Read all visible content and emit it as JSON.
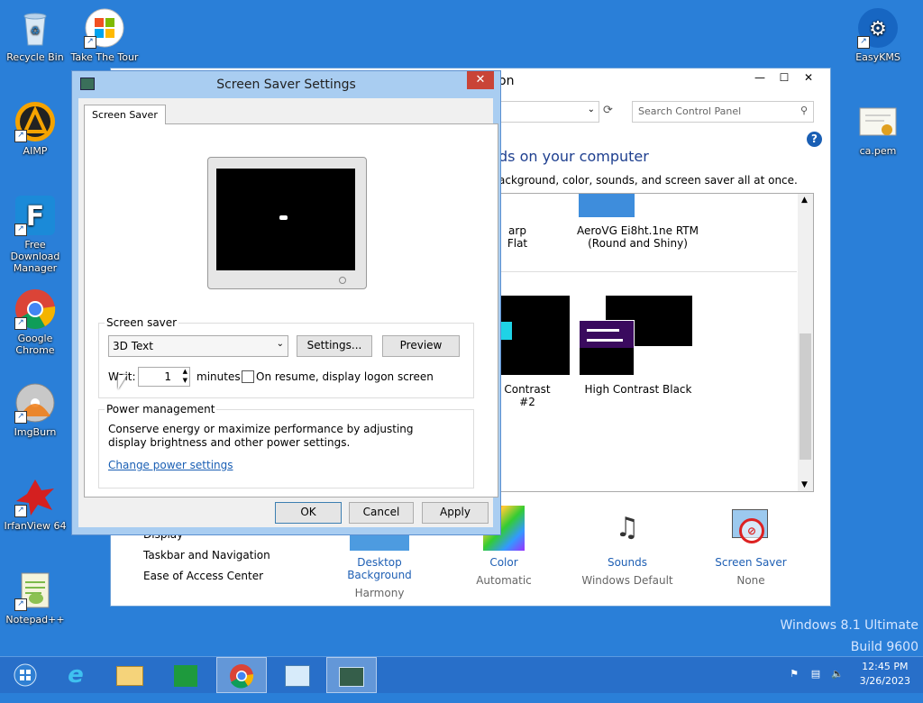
{
  "desktop": {
    "icons": [
      {
        "label": "Recycle Bin",
        "icon": "recycle-bin-icon"
      },
      {
        "label": "Take The Tour",
        "icon": "windows-logo-icon"
      },
      {
        "label": "AIMP",
        "icon": "aimp-icon"
      },
      {
        "label": "Free Download Manager",
        "icon": "fdm-icon"
      },
      {
        "label": "Google Chrome",
        "icon": "chrome-icon"
      },
      {
        "label": "ImgBurn",
        "icon": "imgburn-icon"
      },
      {
        "label": "IrfanView 64",
        "icon": "irfanview-icon"
      },
      {
        "label": "Notepad++",
        "icon": "notepad-plus-icon"
      },
      {
        "label": "EasyKMS",
        "icon": "easykms-icon"
      },
      {
        "label": "ca.pem",
        "icon": "certificate-icon"
      }
    ],
    "watermark_line1": "Windows 8.1 Ultimate",
    "watermark_line2": "Build 9600"
  },
  "control_panel": {
    "title_partial": "on",
    "search_placeholder": "Search Control Panel",
    "heading_partial": "ds on your computer",
    "subheading_partial": "ackground, color, sounds, and screen saver all at once.",
    "themes": [
      {
        "label": "arp Flat"
      },
      {
        "label": "AeroVG Ei8ht.1ne RTM (Round and Shiny)"
      },
      {
        "label": "Contrast #2"
      },
      {
        "label": "High Contrast Black"
      }
    ],
    "left_links": [
      "Display",
      "Taskbar and Navigation",
      "Ease of Access Center"
    ],
    "bottom_items": [
      {
        "label": "Desktop Background",
        "sub": "Harmony"
      },
      {
        "label": "Color",
        "sub": "Automatic"
      },
      {
        "label": "Sounds",
        "sub": "Windows Default"
      },
      {
        "label": "Screen Saver",
        "sub": "None"
      }
    ]
  },
  "screensaver_dialog": {
    "title": "Screen Saver Settings",
    "close_glyph": "✕",
    "tab_label": "Screen Saver",
    "group_screensaver_label": "Screen saver",
    "selected_screensaver": "3D Text",
    "settings_button": "Settings...",
    "preview_button": "Preview",
    "wait_label": "Wait:",
    "wait_value": "1",
    "minutes_label": "minutes",
    "resume_checkbox_label": "On resume, display logon screen",
    "resume_checked": false,
    "group_power_label": "Power management",
    "power_text": "Conserve energy or maximize performance by adjusting display brightness and other power settings.",
    "power_link": "Change power settings",
    "ok_button": "OK",
    "cancel_button": "Cancel",
    "apply_button": "Apply"
  },
  "taskbar": {
    "time": "12:45 PM",
    "date": "3/26/2023"
  }
}
